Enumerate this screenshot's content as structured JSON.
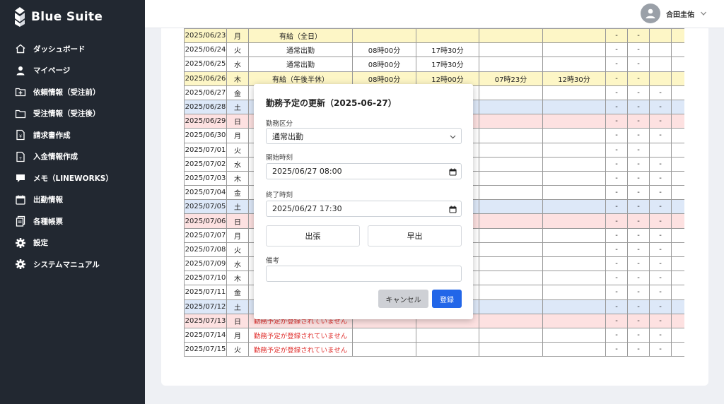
{
  "app": {
    "brand": "Blue Suite"
  },
  "sidebar": {
    "items": [
      {
        "label": "ダッシュボード",
        "icon": "home-icon"
      },
      {
        "label": "マイページ",
        "icon": "user-icon"
      },
      {
        "label": "依頼情報（受注前）",
        "icon": "folder-plus-icon"
      },
      {
        "label": "受注情報（受注後）",
        "icon": "folder-icon"
      },
      {
        "label": "請求書作成",
        "icon": "invoice-icon"
      },
      {
        "label": "入金情報作成",
        "icon": "payment-doc-icon"
      },
      {
        "label": "メモ（LINEWORKS）",
        "icon": "chat-icon"
      },
      {
        "label": "出勤情報",
        "icon": "calendar-icon"
      },
      {
        "label": "各種帳票",
        "icon": "documents-icon"
      },
      {
        "label": "設定",
        "icon": "gear-icon"
      },
      {
        "label": "システムマニュアル",
        "icon": "gear-icon"
      }
    ]
  },
  "header": {
    "user_name": "合田圭佑"
  },
  "colors": {
    "sidebar_bg": "#222831",
    "accent": "#2266e8",
    "weekend_sat": "#dde8f8",
    "weekend_sun": "#fde1e1",
    "leave": "#fdf6c6",
    "error_text": "#e0312f"
  },
  "table": {
    "rows": [
      {
        "date": "2025/06/23",
        "dow": "月",
        "type": "有給（全日）",
        "start": "",
        "end": "",
        "actual_start": "",
        "actual_end": "",
        "c8": "-",
        "c9": "-",
        "c10": "",
        "style": "yellow"
      },
      {
        "date": "2025/06/24",
        "dow": "火",
        "type": "通常出勤",
        "start": "08時00分",
        "end": "17時30分",
        "actual_start": "",
        "actual_end": "",
        "c8": "-",
        "c9": "-",
        "c10": "",
        "style": "white"
      },
      {
        "date": "2025/06/25",
        "dow": "水",
        "type": "通常出勤",
        "start": "08時00分",
        "end": "17時30分",
        "actual_start": "",
        "actual_end": "",
        "c8": "-",
        "c9": "-",
        "c10": "",
        "style": "white"
      },
      {
        "date": "2025/06/26",
        "dow": "木",
        "type": "有給（午後半休）",
        "start": "08時00分",
        "end": "12時00分",
        "actual_start": "07時23分",
        "actual_end": "12時30分",
        "c8": "-",
        "c9": "-",
        "c10": "",
        "style": "yellow"
      },
      {
        "date": "2025/06/27",
        "dow": "金",
        "type": "",
        "start": "",
        "end": "",
        "actual_start": "",
        "actual_end": "",
        "c8": "-",
        "c9": "-",
        "c10": "-",
        "style": "white"
      },
      {
        "date": "2025/06/28",
        "dow": "土",
        "type": "",
        "start": "",
        "end": "",
        "actual_start": "",
        "actual_end": "",
        "c8": "-",
        "c9": "-",
        "c10": "-",
        "style": "blue"
      },
      {
        "date": "2025/06/29",
        "dow": "日",
        "type": "",
        "start": "",
        "end": "",
        "actual_start": "",
        "actual_end": "",
        "c8": "-",
        "c9": "-",
        "c10": "-",
        "style": "pink"
      },
      {
        "date": "2025/06/30",
        "dow": "月",
        "type": "",
        "start": "",
        "end": "",
        "actual_start": "",
        "actual_end": "",
        "c8": "-",
        "c9": "-",
        "c10": "-",
        "style": "white"
      },
      {
        "date": "2025/07/01",
        "dow": "火",
        "type": "",
        "start": "",
        "end": "",
        "actual_start": "",
        "actual_end": "",
        "c8": "-",
        "c9": "-",
        "c10": "",
        "style": "white"
      },
      {
        "date": "2025/07/02",
        "dow": "水",
        "type": "",
        "start": "",
        "end": "",
        "actual_start": "",
        "actual_end": "",
        "c8": "-",
        "c9": "-",
        "c10": "-",
        "style": "white"
      },
      {
        "date": "2025/07/03",
        "dow": "木",
        "type": "",
        "start": "",
        "end": "",
        "actual_start": "",
        "actual_end": "",
        "c8": "-",
        "c9": "-",
        "c10": "-",
        "style": "white"
      },
      {
        "date": "2025/07/04",
        "dow": "金",
        "type": "",
        "start": "",
        "end": "",
        "actual_start": "",
        "actual_end": "",
        "c8": "-",
        "c9": "-",
        "c10": "-",
        "style": "white"
      },
      {
        "date": "2025/07/05",
        "dow": "土",
        "type": "",
        "start": "",
        "end": "",
        "actual_start": "",
        "actual_end": "",
        "c8": "-",
        "c9": "-",
        "c10": "-",
        "style": "blue"
      },
      {
        "date": "2025/07/06",
        "dow": "日",
        "type": "",
        "start": "",
        "end": "",
        "actual_start": "",
        "actual_end": "",
        "c8": "-",
        "c9": "-",
        "c10": "-",
        "style": "pink"
      },
      {
        "date": "2025/07/07",
        "dow": "月",
        "type": "",
        "start": "",
        "end": "",
        "actual_start": "",
        "actual_end": "",
        "c8": "-",
        "c9": "-",
        "c10": "-",
        "style": "white"
      },
      {
        "date": "2025/07/08",
        "dow": "火",
        "type": "",
        "start": "",
        "end": "",
        "actual_start": "",
        "actual_end": "",
        "c8": "-",
        "c9": "-",
        "c10": "-",
        "style": "white"
      },
      {
        "date": "2025/07/09",
        "dow": "水",
        "type": "",
        "start": "",
        "end": "",
        "actual_start": "",
        "actual_end": "",
        "c8": "-",
        "c9": "-",
        "c10": "-",
        "style": "white"
      },
      {
        "date": "2025/07/10",
        "dow": "木",
        "type": "",
        "start": "",
        "end": "",
        "actual_start": "",
        "actual_end": "",
        "c8": "-",
        "c9": "-",
        "c10": "-",
        "style": "white"
      },
      {
        "date": "2025/07/11",
        "dow": "金",
        "type": "",
        "start": "",
        "end": "",
        "actual_start": "",
        "actual_end": "",
        "c8": "-",
        "c9": "-",
        "c10": "-",
        "style": "white"
      },
      {
        "date": "2025/07/12",
        "dow": "土",
        "type": "",
        "start": "",
        "end": "",
        "actual_start": "",
        "actual_end": "",
        "c8": "-",
        "c9": "-",
        "c10": "-",
        "style": "blue"
      },
      {
        "date": "2025/07/13",
        "dow": "日",
        "type": "勤務予定が登録されていません",
        "start": "",
        "end": "",
        "actual_start": "",
        "actual_end": "",
        "c8": "-",
        "c9": "-",
        "c10": "-",
        "style": "pink",
        "unregistered": true
      },
      {
        "date": "2025/07/14",
        "dow": "月",
        "type": "勤務予定が登録されていません",
        "start": "",
        "end": "",
        "actual_start": "",
        "actual_end": "",
        "c8": "-",
        "c9": "-",
        "c10": "-",
        "style": "white",
        "unregistered": true
      },
      {
        "date": "2025/07/15",
        "dow": "火",
        "type": "勤務予定が登録されていません",
        "start": "",
        "end": "",
        "actual_start": "",
        "actual_end": "",
        "c8": "-",
        "c9": "-",
        "c10": "-",
        "style": "white",
        "unregistered": true
      }
    ]
  },
  "modal": {
    "title": "勤務予定の更新（2025-06-27）",
    "work_type_label": "勤務区分",
    "work_type_value": "通常出勤",
    "start_label": "開始時刻",
    "start_value": "2025/06/27 08:00",
    "end_label": "終了時刻",
    "end_value": "2025/06/27 17:30",
    "trip_button": "出張",
    "early_button": "早出",
    "notes_label": "備考",
    "notes_value": "",
    "cancel_button": "キャンセル",
    "save_button": "登録"
  }
}
